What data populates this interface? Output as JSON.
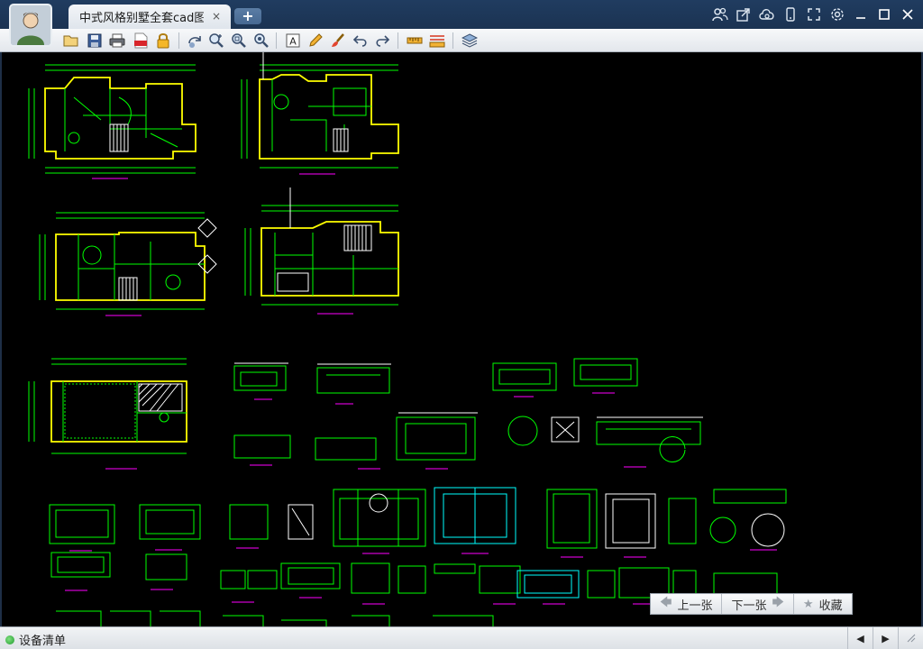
{
  "tab": {
    "title": "中式风格别墅全套cad图...",
    "close": "×"
  },
  "newtab": {
    "label": "+"
  },
  "nav": {
    "prev": "上一张",
    "next": "下一张",
    "favorite": "收藏"
  },
  "status": {
    "label": "设备清单"
  },
  "pager": {
    "prev": "◀",
    "next": "▶"
  },
  "toolbar_icons": [
    "open-folder-icon",
    "save-icon",
    "print-icon",
    "pdf-icon",
    "lock-icon",
    "rotate-icon",
    "zoom-in-icon",
    "zoom-fit-icon",
    "zoom-window-icon",
    "text-icon",
    "pencil-icon",
    "brush-icon",
    "undo-icon",
    "redo-icon",
    "measure-icon",
    "measure-area-icon",
    "layers-icon"
  ],
  "window_icons": [
    "users-icon",
    "share-icon",
    "cloud-icon",
    "mobile-icon",
    "fullscreen-icon",
    "settings-icon",
    "minimize-icon",
    "maximize-icon",
    "close-icon"
  ],
  "colors": {
    "canvas": "#000000",
    "cad_green": "#00ff00",
    "cad_yellow": "#ffff00",
    "cad_magenta": "#ff00ff",
    "cad_white": "#ffffff",
    "cad_cyan": "#00ffff"
  }
}
